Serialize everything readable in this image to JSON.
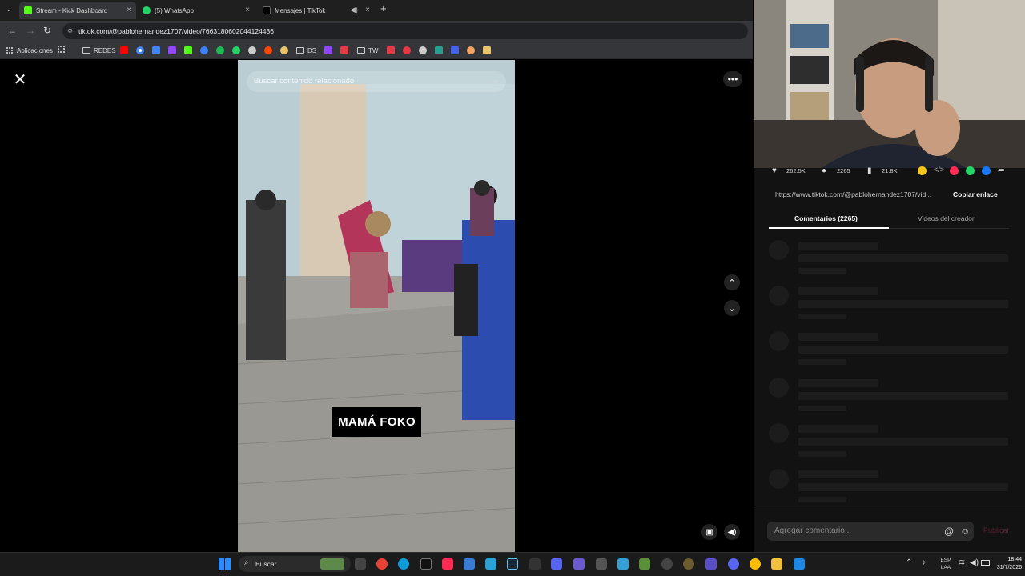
{
  "browser": {
    "tabs": [
      {
        "title": "Stream - Kick Dashboard",
        "favicon_color": "#53fc18"
      },
      {
        "title": "(5) WhatsApp",
        "favicon_color": "#25d366"
      },
      {
        "title": "Mensajes | TikTok",
        "favicon_color": "#ffffff"
      }
    ],
    "url": "tiktok.com/@pablohernandez1707/video/7663180602044124436",
    "bookmarks": {
      "apps_label": "Aplicaciones",
      "folder_redes": "REDES",
      "folder_ds": "DS",
      "folder_tw": "TW"
    }
  },
  "video": {
    "search_placeholder": "Buscar contenido relacionado",
    "caption": "MAMÁ FOKO"
  },
  "stats": {
    "likes": "262.5K",
    "comments": "2265",
    "saves": "21.8K"
  },
  "share": {
    "link": "https://www.tiktok.com/@pablohernandez1707/vid...",
    "copy_label": "Copiar enlace"
  },
  "panel_tabs": {
    "comments": "Comentarios (2265)",
    "creator_videos": "Videos del creador"
  },
  "comment_box": {
    "placeholder": "Agregar comentario...",
    "publish": "Publicar"
  },
  "taskbar": {
    "search": "Buscar",
    "lang_top": "ESP",
    "lang_bottom": "LAA",
    "time": "18:44",
    "date": "31/7/2026"
  },
  "colors": {
    "accent_pink": "#fe2c55",
    "panel_bg": "#121212",
    "kick_green": "#53fc18"
  }
}
